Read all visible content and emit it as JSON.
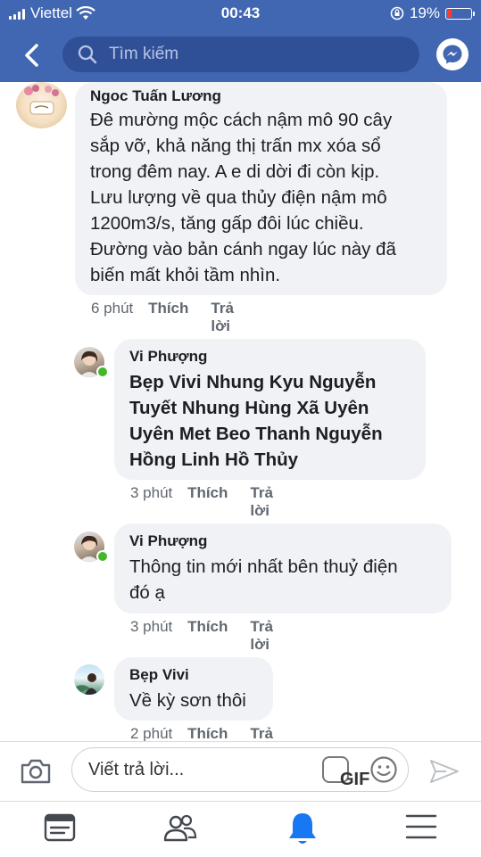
{
  "status": {
    "carrier": "Viettel",
    "time": "00:43",
    "battery": "19%"
  },
  "search": {
    "placeholder": "Tìm kiếm"
  },
  "comments": [
    {
      "name": "Ngoc Tuấn Lương",
      "text": "Đê mường mộc cách nậm mô 90 cây\nsắp vỡ, khả năng thị trấn mx xóa sổ\ntrong đêm nay. A e di dời đi còn kịp.\nLưu lượng về qua thủy điện nậm mô\n1200m3/s, tăng gấp đôi lúc chiều.\nĐường vào bản cánh ngay lúc này đã\nbiến mất khỏi tầm nhìn.",
      "time": "6 phút",
      "like": "Thích",
      "reply": "Trả lời"
    },
    {
      "name": "Vi Phượng",
      "text": "Bẹp Vivi Nhung Kyu Nguyễn\nTuyết Nhung Hùng Xã Uyên\nUyên Met Beo Thanh Nguyễn\nHồng Linh Hồ Thủy",
      "time": "3 phút",
      "like": "Thích",
      "reply": "Trả lời"
    },
    {
      "name": "Vi Phượng",
      "text": "Thông tin mới nhất bên thuỷ điện\nđó ạ",
      "time": "3 phút",
      "like": "Thích",
      "reply": "Trả lời"
    },
    {
      "name": "Bẹp Vivi",
      "text": "Về kỳ sơn thôi",
      "time": "2 phút",
      "like": "Thích",
      "reply": "Trả lời"
    }
  ],
  "composer": {
    "placeholder": "Viết trả lời...",
    "gif_label": "GIF"
  },
  "colors": {
    "header": "#4267b2",
    "bubble": "#f0f2f5",
    "online": "#42b72a",
    "active_tab": "#1877f2"
  },
  "tabs": [
    "news-feed-icon",
    "friends-icon",
    "notifications-icon",
    "menu-icon"
  ]
}
